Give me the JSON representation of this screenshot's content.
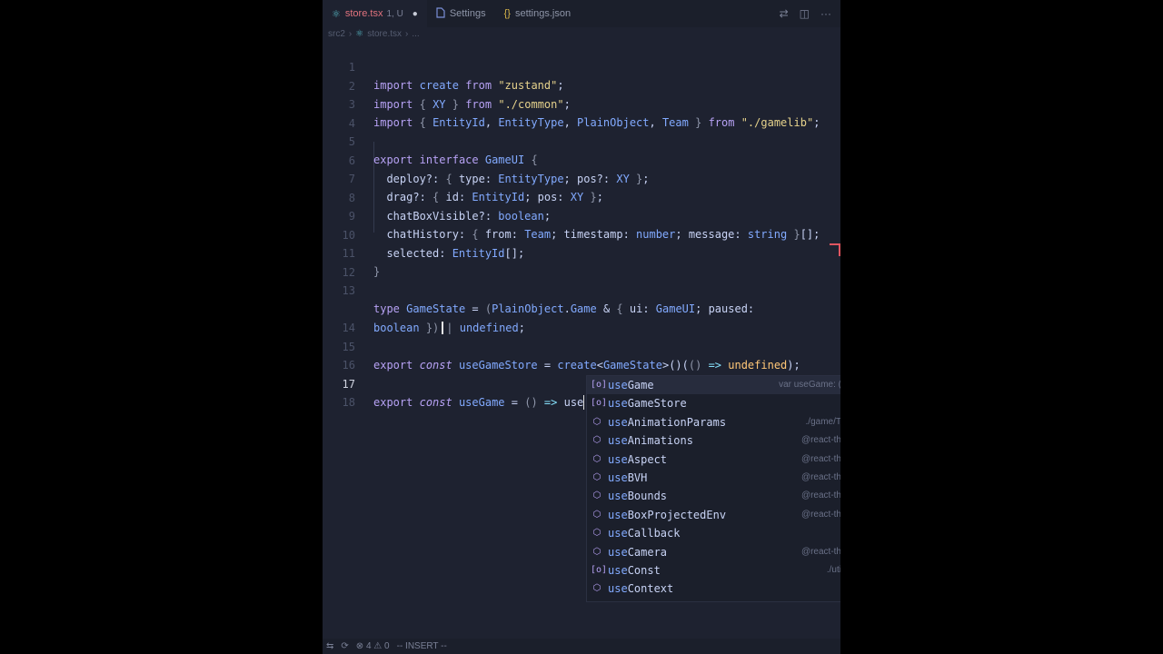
{
  "tabs": [
    {
      "label": "store.tsx",
      "sub": "1, U",
      "icon": "react-icon",
      "active": true,
      "modified_dot": "●"
    },
    {
      "label": "Settings",
      "icon": "settings-icon",
      "active": false
    },
    {
      "label": "settings.json",
      "icon": "json-icon",
      "active": false
    }
  ],
  "breadcrumb": {
    "folder": "src2",
    "file": "store.tsx",
    "rest": "..."
  },
  "code": {
    "line_numbers": [
      "1",
      "2",
      "3",
      "4",
      "5",
      "6",
      "7",
      "8",
      "9",
      "10",
      "11",
      "12",
      "13",
      "",
      "14",
      "15",
      "16",
      "17",
      "18"
    ],
    "current_line": "17",
    "typed": "use"
  },
  "suggest": {
    "items": [
      {
        "label": "useGame",
        "detail": "var useGame: (",
        "icon": "variable-icon"
      },
      {
        "label": "useGameStore",
        "detail": "",
        "icon": "variable-icon"
      },
      {
        "label": "useAnimationParams",
        "detail": "./game/T",
        "icon": "module-icon"
      },
      {
        "label": "useAnimations",
        "detail": "@react-th",
        "icon": "module-icon"
      },
      {
        "label": "useAspect",
        "detail": "@react-th",
        "icon": "module-icon"
      },
      {
        "label": "useBVH",
        "detail": "@react-th",
        "icon": "module-icon"
      },
      {
        "label": "useBounds",
        "detail": "@react-th",
        "icon": "module-icon"
      },
      {
        "label": "useBoxProjectedEnv",
        "detail": "@react-th",
        "icon": "module-icon"
      },
      {
        "label": "useCallback",
        "detail": "",
        "icon": "module-icon"
      },
      {
        "label": "useCamera",
        "detail": "@react-th",
        "icon": "module-icon"
      },
      {
        "label": "useConst",
        "detail": "./uti",
        "icon": "variable-icon"
      },
      {
        "label": "useContext",
        "detail": "",
        "icon": "module-icon"
      }
    ]
  },
  "status": {
    "errors": "4",
    "warnings": "0",
    "mode": "-- INSERT --"
  }
}
